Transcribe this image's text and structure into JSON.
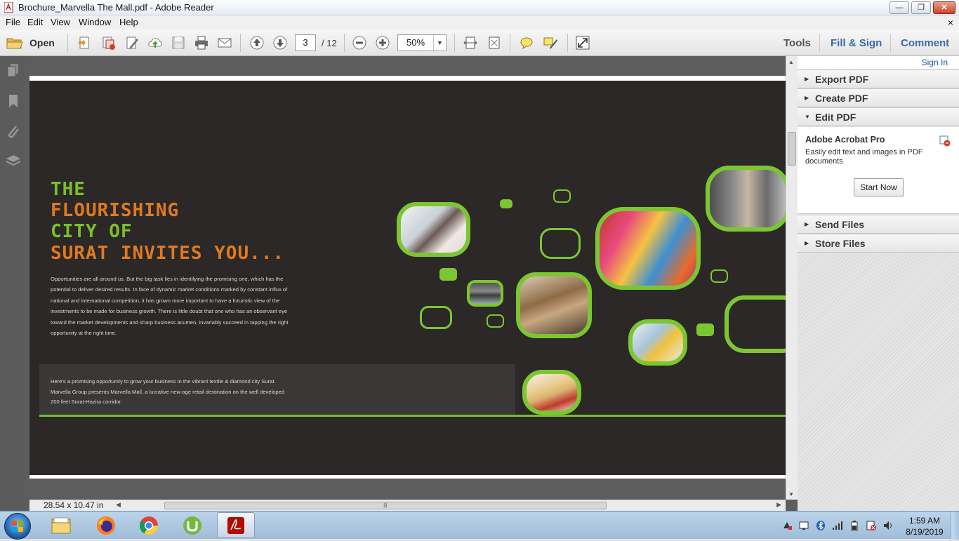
{
  "window": {
    "title": "Brochure_Marvella The Mall.pdf - Adobe Reader",
    "min_glyph": "—",
    "max_glyph": "❐",
    "close_glyph": "✕"
  },
  "menu": {
    "items": [
      "File",
      "Edit",
      "View",
      "Window",
      "Help"
    ],
    "close_doc_glyph": "×"
  },
  "toolbar": {
    "open_label": "Open",
    "current_page": "3",
    "page_total": "/ 12",
    "zoom": "50%",
    "zoom_dropdown_glyph": "▼"
  },
  "right_links": {
    "tools": "Tools",
    "fill_sign": "Fill & Sign",
    "comment": "Comment"
  },
  "brochure": {
    "headline": [
      "THE",
      "FLOURISHING",
      "CITY OF",
      "SURAT INVITES YOU..."
    ],
    "headline_colors": [
      "#7cbf2e",
      "#e07a1f",
      "#7cbf2e",
      "#e07a1f"
    ],
    "body": "Opportunities are all around us. But the big task lies in identifying the promising one, which has the potential to deliver desired results. In face of dynamic market conditions marked by constant influx of national and international competition, it has grown more important to have a futuristic view of the investments to be made for business growth. There is little doubt that one who has an observant eye toward the market developments and sharp business acumen, invariably succeed in tapping the right opportunity at the right time.",
    "promo": "Here's a promising opportunity to grow your business in the vibrant textile & diamond city Surat. Marvella Group presents Marvella Mall, a lucrative new-age retail destination on the well developed 200 feet Surat-Hazira corridor.",
    "accent_color": "#7cc631"
  },
  "status": {
    "page_size": "28.54 x 10.47 in",
    "scroll_grip": "|||"
  },
  "side_panel": {
    "sign_in": "Sign In",
    "sections": {
      "export_pdf": "Export PDF",
      "create_pdf": "Create PDF",
      "edit_pdf": "Edit PDF",
      "send_files": "Send Files",
      "store_files": "Store Files"
    },
    "collapsed_arrow": "▶",
    "expanded_arrow": "▼",
    "edit_heading": "Adobe Acrobat Pro",
    "edit_desc": "Easily edit text and images in PDF documents",
    "start_now": "Start Now"
  },
  "taskbar": {
    "time": "1:59 AM",
    "date": "8/19/2019"
  }
}
